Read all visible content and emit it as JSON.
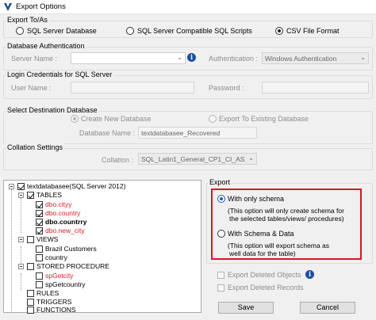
{
  "window": {
    "title": "Export Options"
  },
  "export_to": {
    "legend": "Export To/As",
    "options": [
      "SQL Server Database",
      "SQL Server Compatible SQL Scripts",
      "CSV File Format"
    ],
    "selected_index": 2
  },
  "db_auth": {
    "legend": "Database Authentication",
    "server_label": "Server Name :",
    "server_value": "",
    "auth_label": "Authentication :",
    "auth_value": "Windows Authentication"
  },
  "login": {
    "legend": "Login Credentials for SQL Server",
    "user_label": "User Name :",
    "user_value": "",
    "password_label": "Password :",
    "password_value": ""
  },
  "destination": {
    "legend": "Select Destination Database",
    "create_new_label": "Create New Database",
    "export_existing_label": "Export To Existing Database",
    "db_name_label": "Database Name :",
    "db_name_value": "textdatabasee_Recovered"
  },
  "collation": {
    "legend": "Collation Settings",
    "label": "Collation :",
    "value": "SQL_Latin1_General_CP1_CI_AS"
  },
  "tree": {
    "root": "textdatabasee(SQL Server 2012)",
    "tables": "TABLES",
    "table_items": [
      "dbo.cityy",
      "dbo.country",
      "dbo.countrry",
      "dbo.new_city"
    ],
    "views": "VIEWS",
    "view_items": [
      "Brazil Customers",
      "country"
    ],
    "procedures": "STORED PROCEDURE",
    "procedure_items": [
      "spGetcity",
      "spGetcountry"
    ],
    "rules": "RULES",
    "triggers": "TRIGGERS",
    "functions": "FUNCTIONS"
  },
  "export": {
    "legend": "Export",
    "schema_only_label": "With only schema",
    "schema_only_desc_1": "(This option will only create schema for",
    "schema_only_desc_2": "the selected tables/views/ procedures)",
    "schema_data_label": "With Schema & Data",
    "schema_data_desc_1": "(This option will export schema as",
    "schema_data_desc_2": "well data for the table)",
    "selected": "schema_only"
  },
  "deleted": {
    "export_deleted_objects": "Export Deleted Objects",
    "export_deleted_records": "Export Deleted Records"
  },
  "buttons": {
    "save": "Save",
    "cancel": "Cancel"
  },
  "colors": {
    "highlight": "#d8152a",
    "deleted_item": "#e01b24",
    "info": "#1b4fa3"
  }
}
